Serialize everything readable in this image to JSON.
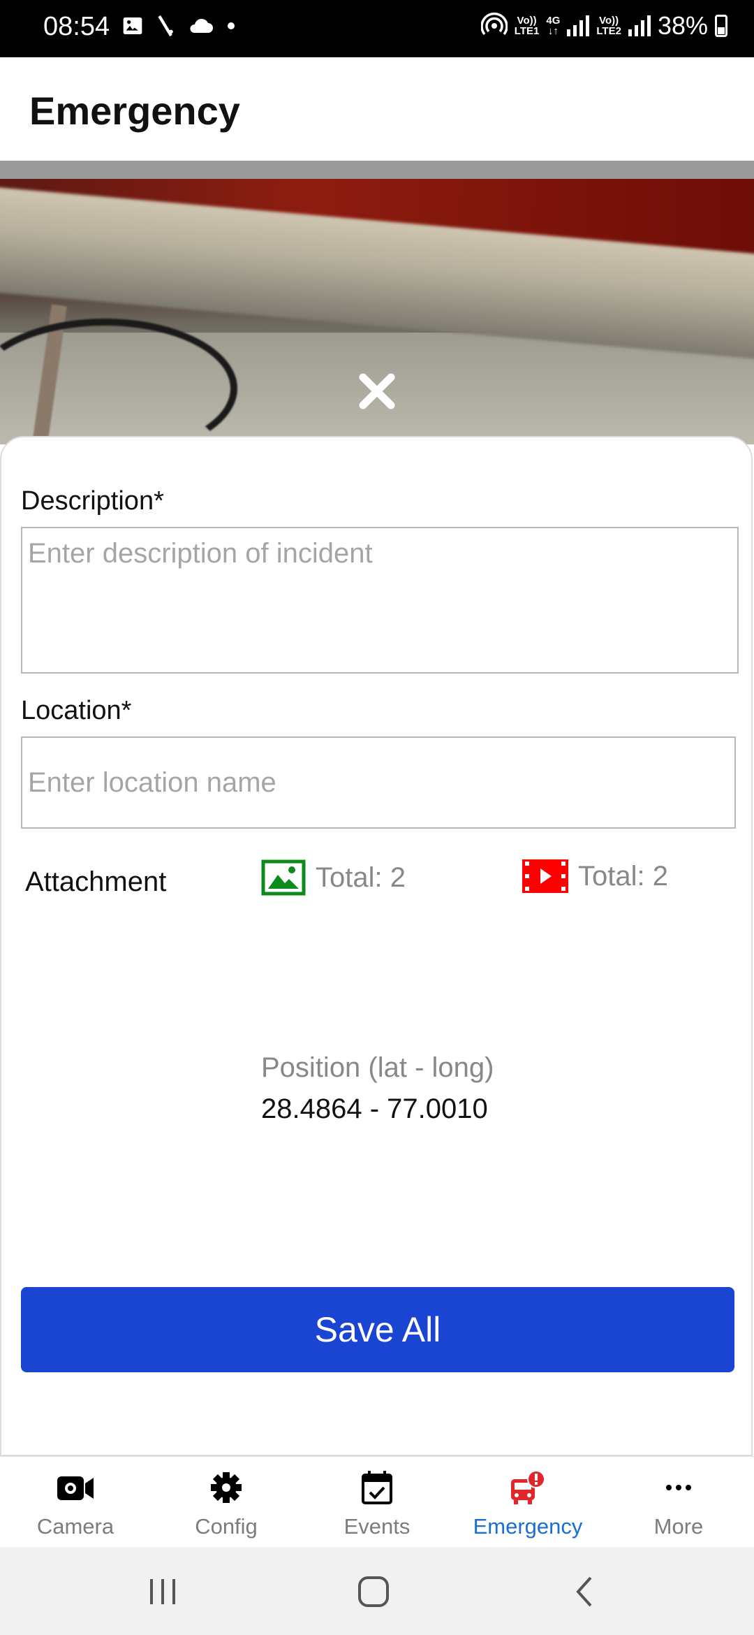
{
  "status_bar": {
    "time": "08:54",
    "battery": "38%",
    "sim1_label_top": "Vo))",
    "sim1_label_bottom": "LTE1",
    "net_label_top": "4G",
    "net_label_bottom": "↓↑",
    "sim2_label_top": "Vo))",
    "sim2_label_bottom": "LTE2"
  },
  "header": {
    "title": "Emergency"
  },
  "form": {
    "description_label": "Description*",
    "description_placeholder": "Enter description of incident",
    "location_label": "Location*",
    "location_placeholder": "Enter location name",
    "attachment_label": "Attachment",
    "image_total": "Total: 2",
    "video_total": "Total: 2",
    "image_icon_color": "#0c8a1c",
    "video_icon_color": "#ff0000",
    "position_label": "Position (lat - long)",
    "position_value": "28.4864 - 77.0010",
    "save_label": "Save All"
  },
  "bottom_nav": {
    "active": "Emergency",
    "active_color": "#1a6fd6",
    "items": [
      {
        "label": "Camera",
        "icon": "camera-icon"
      },
      {
        "label": "Config",
        "icon": "gear-icon"
      },
      {
        "label": "Events",
        "icon": "calendar-check-icon"
      },
      {
        "label": "Emergency",
        "icon": "emergency-alert-icon"
      },
      {
        "label": "More",
        "icon": "more-dots-icon"
      }
    ]
  }
}
